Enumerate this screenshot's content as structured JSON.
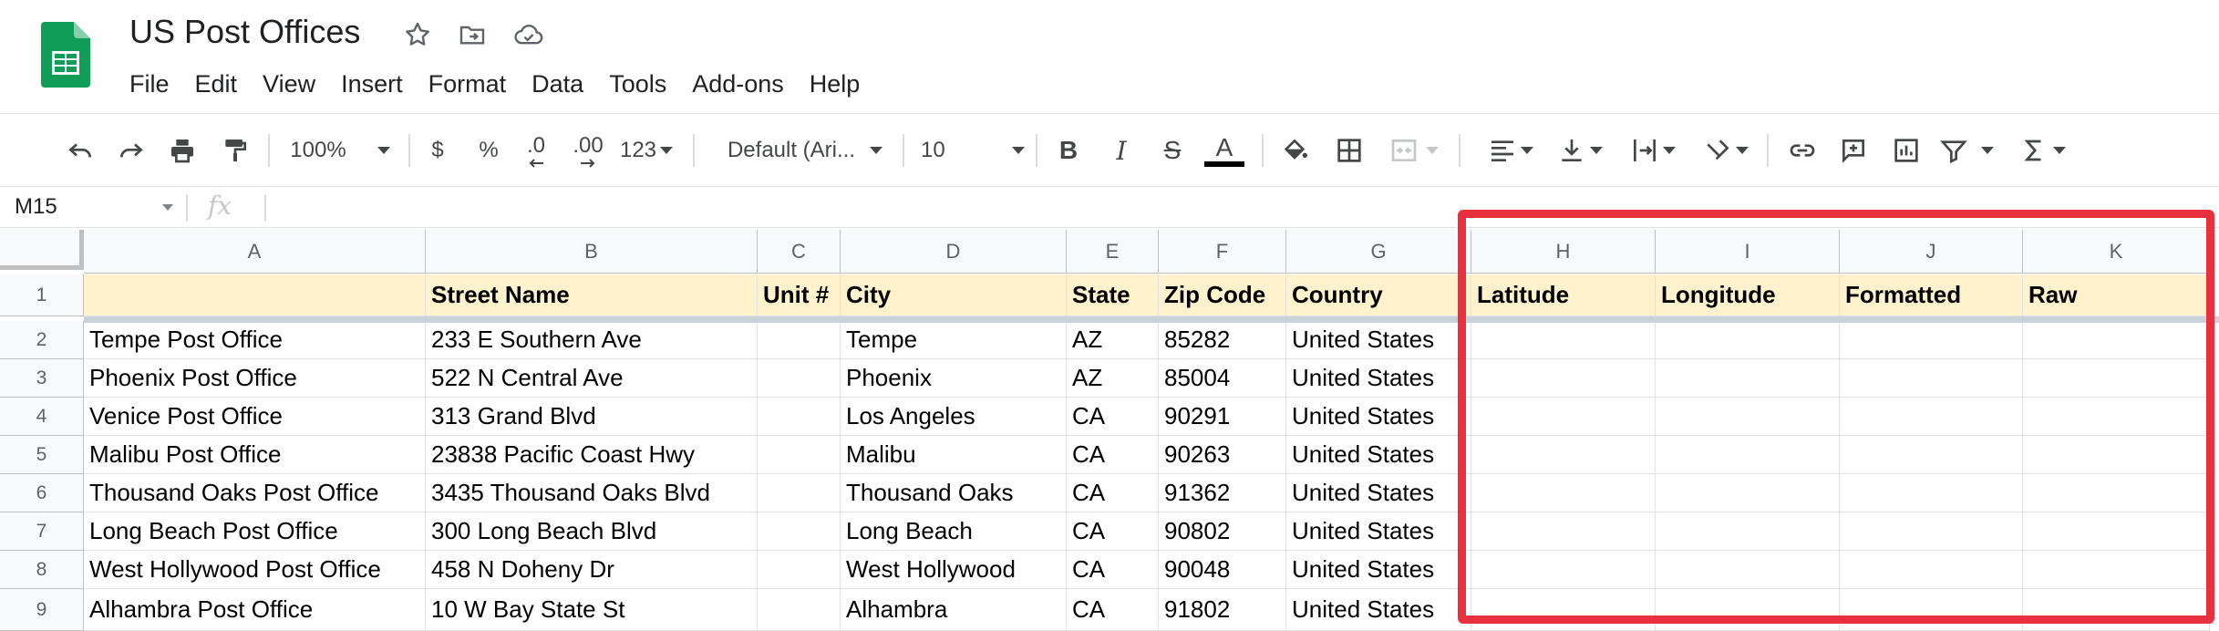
{
  "app": {
    "title": "US Post Offices",
    "icons": [
      "star-icon",
      "move-to-folder-icon",
      "cloud-saved-icon"
    ],
    "brand_color": "#0f9d58"
  },
  "menu": [
    {
      "label": "File"
    },
    {
      "label": "Edit"
    },
    {
      "label": "View"
    },
    {
      "label": "Insert"
    },
    {
      "label": "Format"
    },
    {
      "label": "Data"
    },
    {
      "label": "Tools"
    },
    {
      "label": "Add-ons"
    },
    {
      "label": "Help"
    }
  ],
  "toolbar": {
    "zoom": "100%",
    "currency": "$",
    "percent": "%",
    "decrease_decimal": ".0",
    "increase_decimal": ".00",
    "more_formats": "123",
    "font": "Default (Ari...",
    "font_size": "10",
    "bold": "B",
    "italic": "I",
    "strike": "S",
    "text_color_letter": "A"
  },
  "formula_bar": {
    "cell_ref": "M15",
    "fx": "fx"
  },
  "grid": {
    "columns": [
      "A",
      "B",
      "C",
      "D",
      "E",
      "F",
      "G",
      "H",
      "I",
      "J",
      "K"
    ],
    "rows": [
      [
        "",
        "Street Name",
        "Unit #",
        "City",
        "State",
        "Zip Code",
        "Country",
        "Latitude",
        "Longitude",
        "Formatted",
        "Raw"
      ],
      [
        "Tempe Post Office",
        "233 E Southern Ave",
        "",
        "Tempe",
        "AZ",
        "85282",
        "United States",
        "",
        "",
        "",
        ""
      ],
      [
        "Phoenix Post Office",
        "522 N Central Ave",
        "",
        "Phoenix",
        "AZ",
        "85004",
        "United States",
        "",
        "",
        "",
        ""
      ],
      [
        "Venice Post Office",
        "313 Grand Blvd",
        "",
        "Los Angeles",
        "CA",
        "90291",
        "United States",
        "",
        "",
        "",
        ""
      ],
      [
        "Malibu Post Office",
        "23838 Pacific Coast Hwy",
        "",
        "Malibu",
        "CA",
        "90263",
        "United States",
        "",
        "",
        "",
        ""
      ],
      [
        "Thousand Oaks Post Office",
        "3435 Thousand Oaks Blvd",
        "",
        "Thousand Oaks",
        "CA",
        "91362",
        "United States",
        "",
        "",
        "",
        ""
      ],
      [
        "Long Beach Post Office",
        "300 Long Beach Blvd",
        "",
        "Long Beach",
        "CA",
        "90802",
        "United States",
        "",
        "",
        "",
        ""
      ],
      [
        "West Hollywood Post Office",
        "458 N Doheny Dr",
        "",
        "West Hollywood",
        "CA",
        "90048",
        "United States",
        "",
        "",
        "",
        ""
      ],
      [
        "Alhambra Post Office",
        "10 W Bay State St",
        "",
        "Alhambra",
        "CA",
        "91802",
        "United States",
        "",
        "",
        "",
        ""
      ]
    ],
    "row_numbers": [
      "1",
      "2",
      "3",
      "4",
      "5",
      "6",
      "7",
      "8",
      "9"
    ],
    "header_fill": "#fff2cc"
  },
  "annotation": {
    "highlight_color": "#e8303f"
  }
}
